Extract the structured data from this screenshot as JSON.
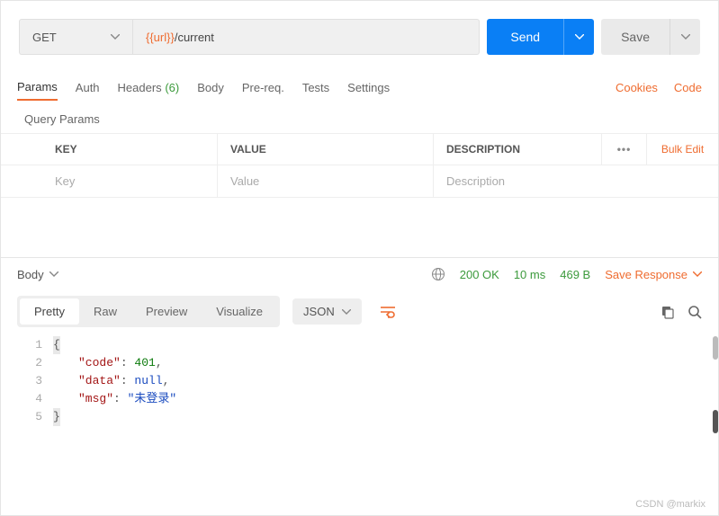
{
  "request": {
    "method": "GET",
    "url_var": "{{url}}",
    "url_path": "/current",
    "send_label": "Send",
    "save_label": "Save"
  },
  "tabs": {
    "items": [
      "Params",
      "Auth",
      "Headers",
      "Body",
      "Pre-req.",
      "Tests",
      "Settings"
    ],
    "headers_count": "(6)",
    "right": {
      "cookies": "Cookies",
      "code": "Code"
    }
  },
  "params": {
    "section_title": "Query Params",
    "head": {
      "key": "KEY",
      "value": "VALUE",
      "desc": "DESCRIPTION",
      "bulk": "Bulk Edit"
    },
    "placeholder": {
      "key": "Key",
      "value": "Value",
      "desc": "Description"
    }
  },
  "response": {
    "body_label": "Body",
    "status": "200 OK",
    "time": "10 ms",
    "size": "469 B",
    "save_response": "Save Response",
    "views": {
      "pretty": "Pretty",
      "raw": "Raw",
      "preview": "Preview",
      "visualize": "Visualize"
    },
    "format": "JSON"
  },
  "json_body": {
    "lines": [
      "1",
      "2",
      "3",
      "4",
      "5"
    ],
    "k_code": "\"code\"",
    "v_code": "401",
    "k_data": "\"data\"",
    "v_data": "null",
    "k_msg": "\"msg\"",
    "v_msg": "\"未登录\""
  },
  "watermark": "CSDN @markix"
}
